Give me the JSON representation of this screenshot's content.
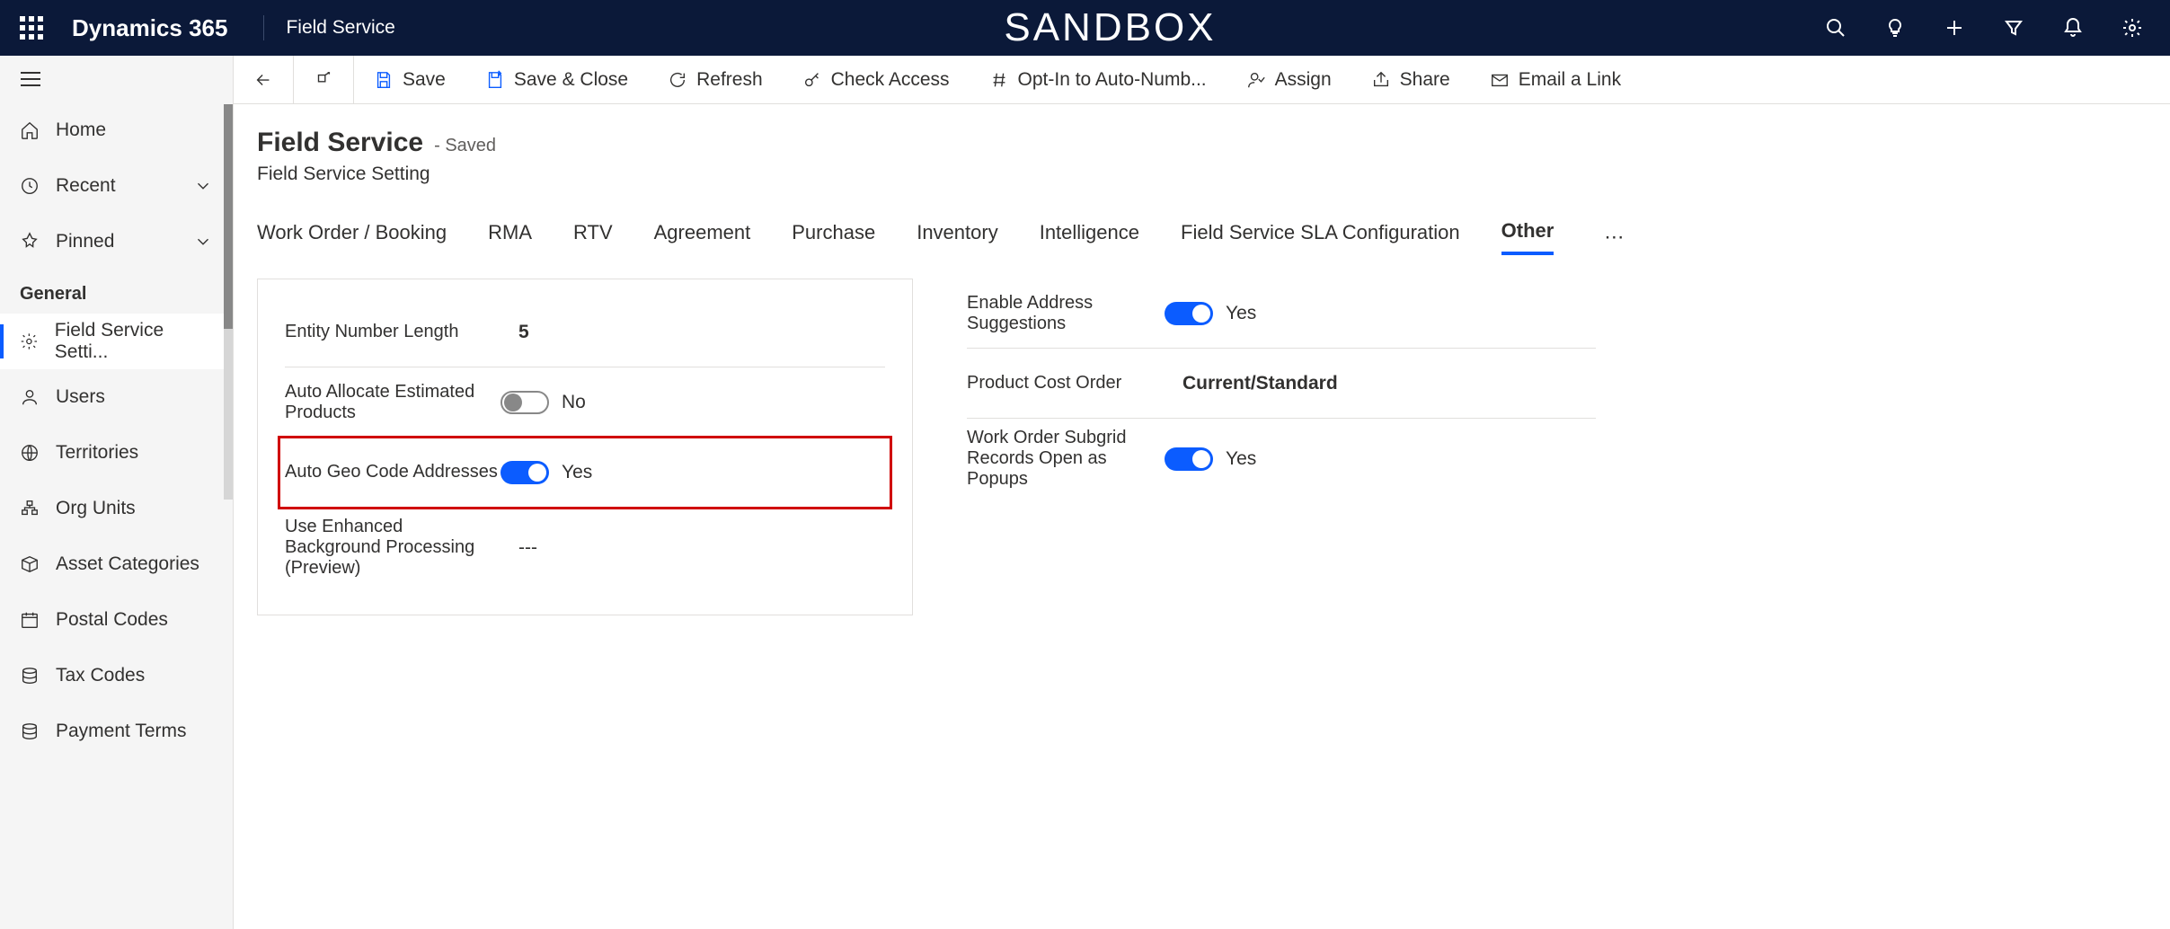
{
  "header": {
    "brand": "Dynamics 365",
    "app": "Field Service",
    "env_badge": "SANDBOX"
  },
  "sidebar": {
    "home": "Home",
    "recent": "Recent",
    "pinned": "Pinned",
    "group": "General",
    "items": {
      "fss": "Field Service Setti...",
      "users": "Users",
      "territories": "Territories",
      "orgunits": "Org Units",
      "assetcat": "Asset Categories",
      "postal": "Postal Codes",
      "taxcodes": "Tax Codes",
      "payterms": "Payment Terms"
    }
  },
  "commands": {
    "save": "Save",
    "saveclose": "Save & Close",
    "refresh": "Refresh",
    "checkaccess": "Check Access",
    "optin": "Opt-In to Auto-Numb...",
    "assign": "Assign",
    "share": "Share",
    "emaillink": "Email a Link"
  },
  "form": {
    "title": "Field Service",
    "status": "- Saved",
    "subtitle": "Field Service Setting"
  },
  "tabs": {
    "t0": "Work Order / Booking",
    "t1": "RMA",
    "t2": "RTV",
    "t3": "Agreement",
    "t4": "Purchase",
    "t5": "Inventory",
    "t6": "Intelligence",
    "t7": "Field Service SLA Configuration",
    "t8": "Other"
  },
  "fields_left": {
    "entity_number_length": {
      "label": "Entity Number Length",
      "value": "5"
    },
    "auto_allocate": {
      "label": "Auto Allocate Estimated Products",
      "value": "No",
      "on": false
    },
    "auto_geocode": {
      "label": "Auto Geo Code Addresses",
      "value": "Yes",
      "on": true
    },
    "enhanced_bg": {
      "label": "Use Enhanced Background Processing (Preview)",
      "value": "---"
    }
  },
  "fields_right": {
    "enable_addr": {
      "label": "Enable Address Suggestions",
      "value": "Yes",
      "on": true
    },
    "product_cost": {
      "label": "Product Cost Order",
      "value": "Current/Standard"
    },
    "wo_subgrid": {
      "label": "Work Order Subgrid Records Open as Popups",
      "value": "Yes",
      "on": true
    }
  }
}
